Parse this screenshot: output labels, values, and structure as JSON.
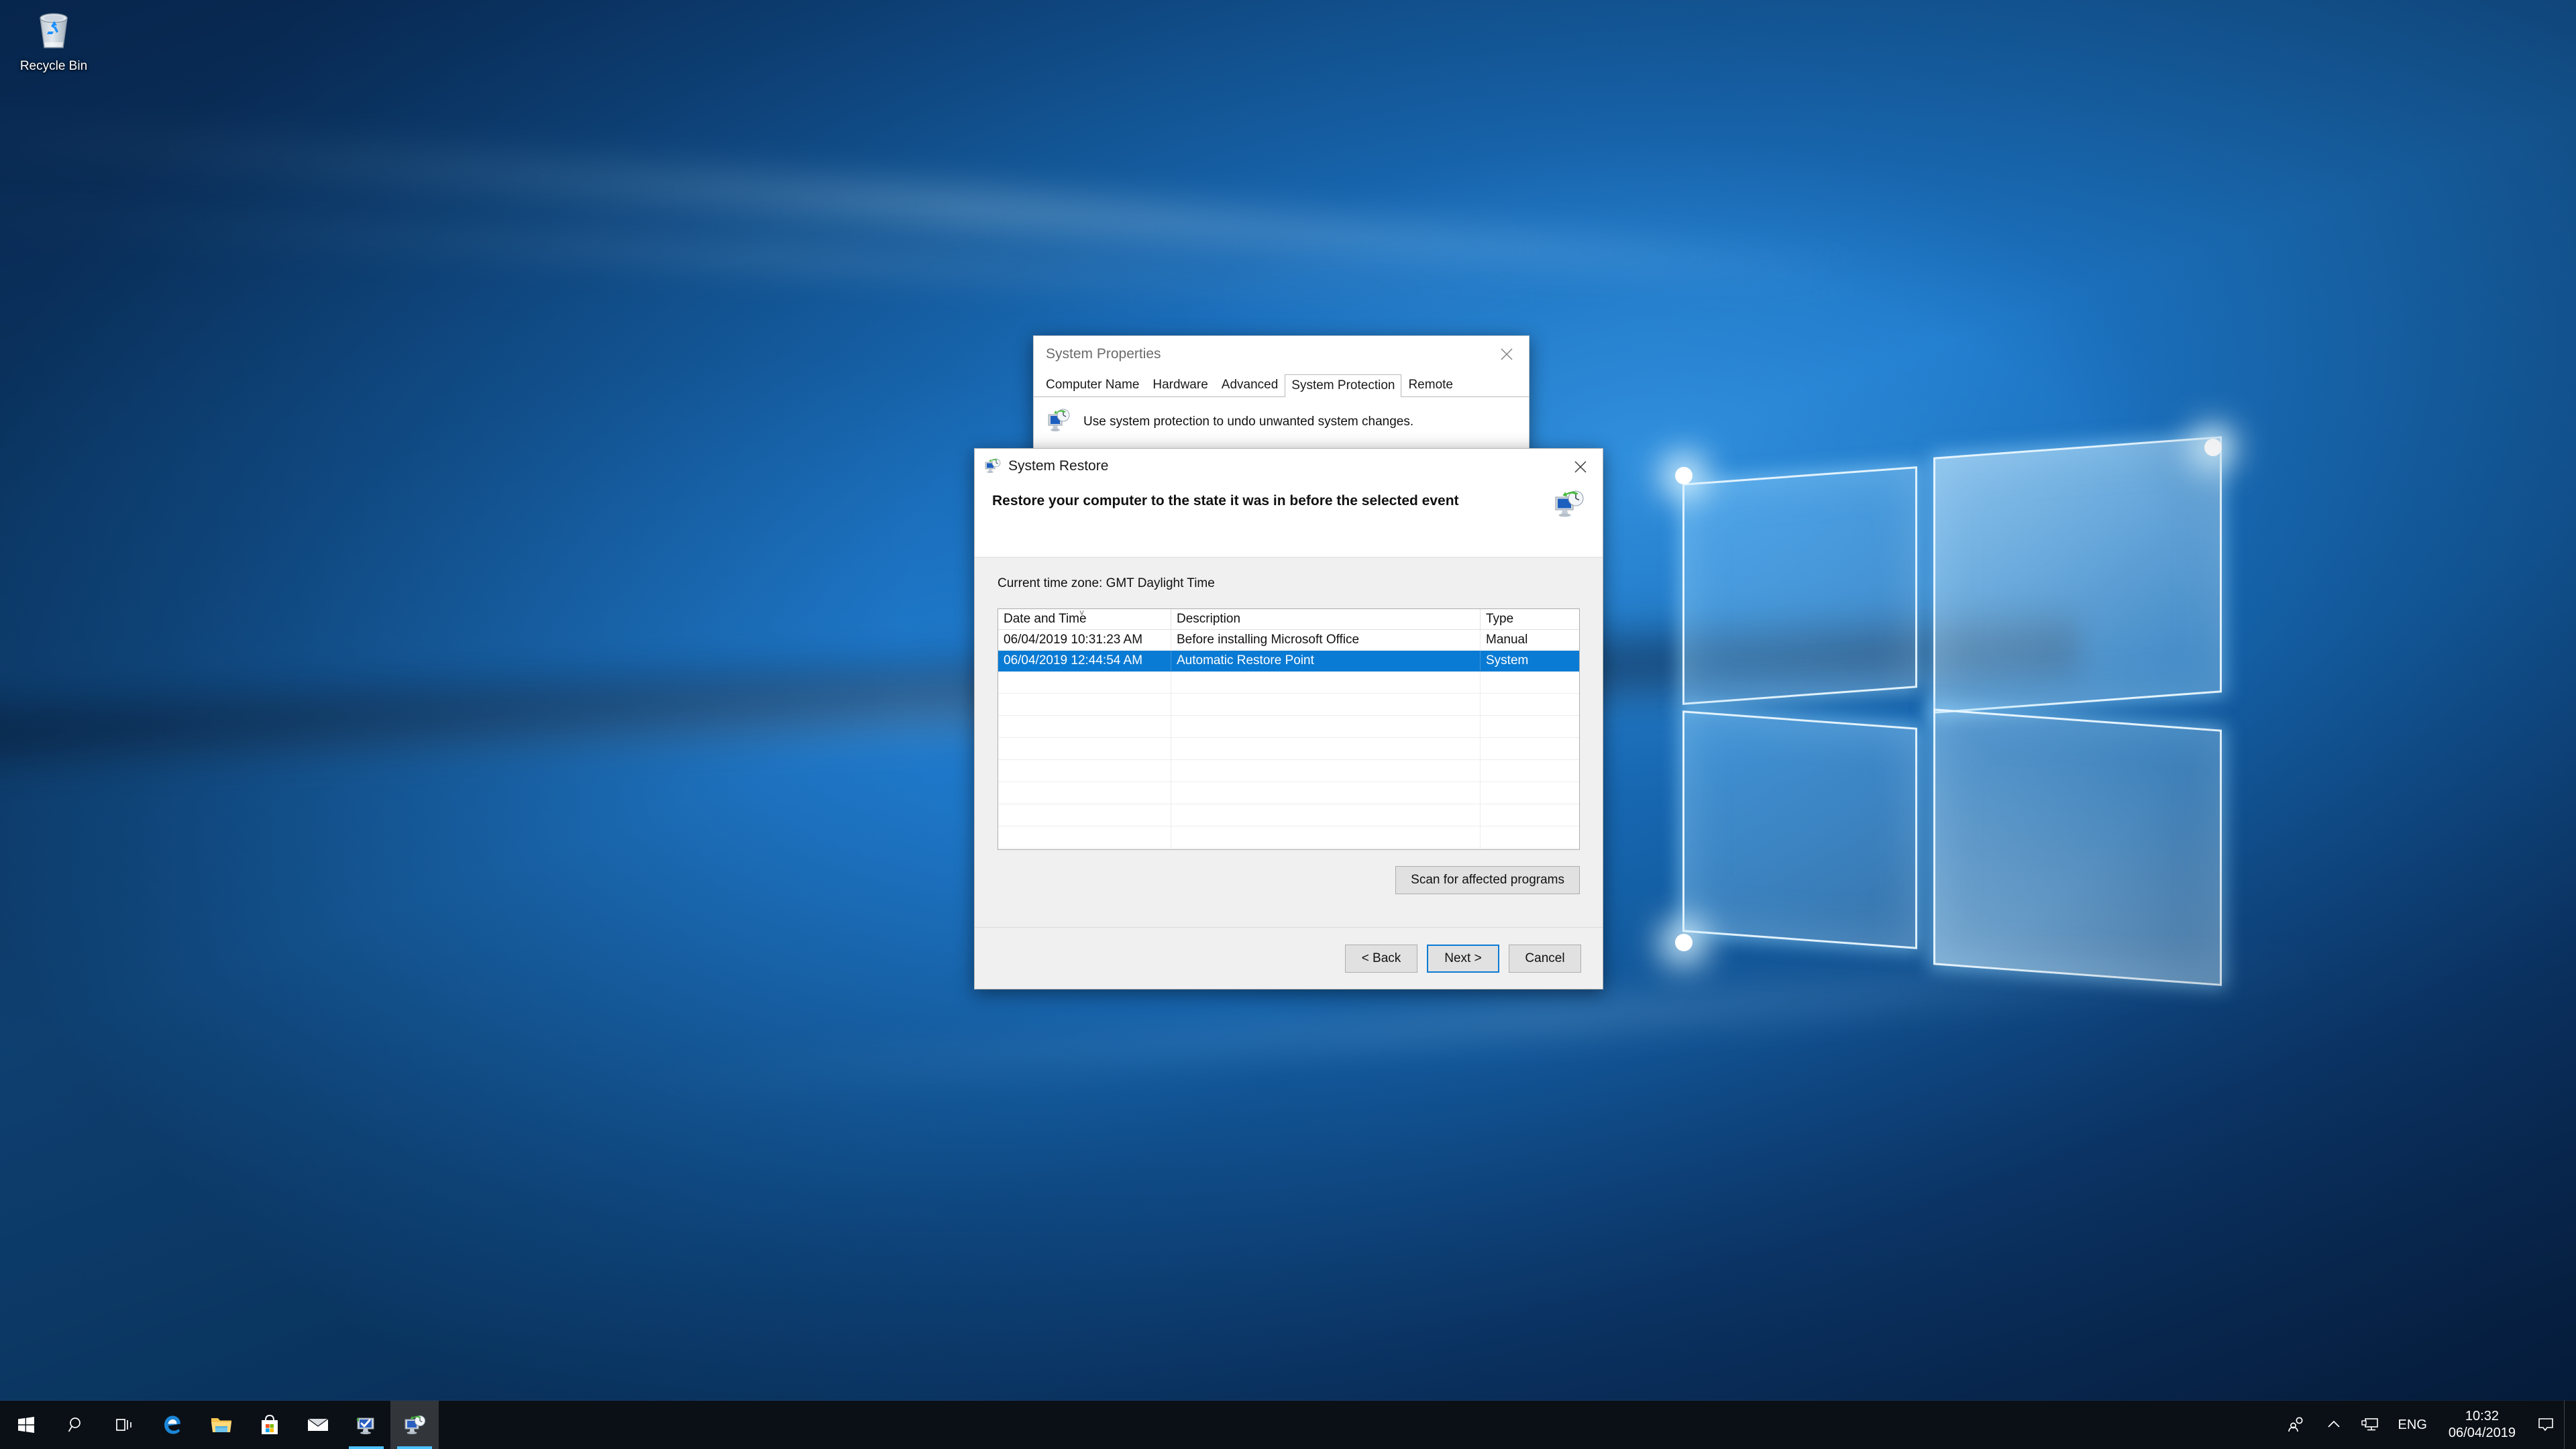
{
  "desktop": {
    "icons": [
      {
        "name": "recycle-bin",
        "label": "Recycle Bin",
        "icon": "recycle-bin-icon"
      }
    ],
    "wallpaper_colors": {
      "deep_blue": "#08254b",
      "mid_blue": "#1663ab",
      "bright_blue": "#1d79c9",
      "glow": "#a0dcff"
    }
  },
  "system_properties": {
    "title": "System Properties",
    "close_label": "Close",
    "tabs": [
      {
        "label": "Computer Name",
        "active": false
      },
      {
        "label": "Hardware",
        "active": false
      },
      {
        "label": "Advanced",
        "active": false
      },
      {
        "label": "System Protection",
        "active": true
      },
      {
        "label": "Remote",
        "active": false
      }
    ],
    "body_text": "Use system protection to undo unwanted system changes.",
    "body_icon": "system-protection-icon"
  },
  "system_restore": {
    "title": "System Restore",
    "title_icon": "system-restore-icon",
    "close_label": "Close",
    "heading": "Restore your computer to the state it was in before the selected event",
    "header_icon": "system-restore-large-icon",
    "time_zone_label": "Current time zone: GMT Daylight Time",
    "list": {
      "columns": [
        {
          "label": "Date and Time",
          "sorted": true,
          "sort_glyph": "chevron-down-icon"
        },
        {
          "label": "Description",
          "sorted": false
        },
        {
          "label": "Type",
          "sorted": false
        }
      ],
      "rows": [
        {
          "date": "06/04/2019 10:31:23 AM",
          "description": "Before installing Microsoft Office",
          "type": "Manual",
          "selected": false
        },
        {
          "date": "06/04/2019 12:44:54 AM",
          "description": "Automatic Restore Point",
          "type": "System",
          "selected": true
        }
      ],
      "empty_row_count": 9,
      "selection_color": "#0a7bd4"
    },
    "scan_button": "Scan for affected programs",
    "buttons": {
      "back": "< Back",
      "next": "Next >",
      "cancel": "Cancel",
      "default_button": "Next >",
      "focus_color": "#0a7bd4"
    }
  },
  "taskbar": {
    "start_button": "Start",
    "items": [
      {
        "name": "search",
        "icon": "search-icon",
        "active": false,
        "running": false
      },
      {
        "name": "task-view",
        "icon": "task-view-icon",
        "active": false,
        "running": false
      },
      {
        "name": "microsoft-edge",
        "icon": "edge-icon",
        "active": false,
        "running": false
      },
      {
        "name": "file-explorer",
        "icon": "folder-icon",
        "active": false,
        "running": false
      },
      {
        "name": "microsoft-store",
        "icon": "store-icon",
        "active": false,
        "running": false
      },
      {
        "name": "mail",
        "icon": "mail-icon",
        "active": false,
        "running": false
      },
      {
        "name": "system-properties",
        "icon": "system-properties-icon",
        "active": false,
        "running": true
      },
      {
        "name": "system-restore",
        "icon": "system-restore-icon",
        "active": true,
        "running": true
      }
    ],
    "tray": [
      {
        "name": "people",
        "icon": "people-icon"
      },
      {
        "name": "show-hidden",
        "icon": "chevron-up-icon"
      },
      {
        "name": "network",
        "icon": "network-monitor-icon"
      }
    ],
    "language": "ENG",
    "clock": {
      "time": "10:32",
      "date": "06/04/2019"
    },
    "action_center_icon": "speech-bubble-icon",
    "background_color": "#0b1016",
    "accent_color": "#4cc2ff"
  }
}
